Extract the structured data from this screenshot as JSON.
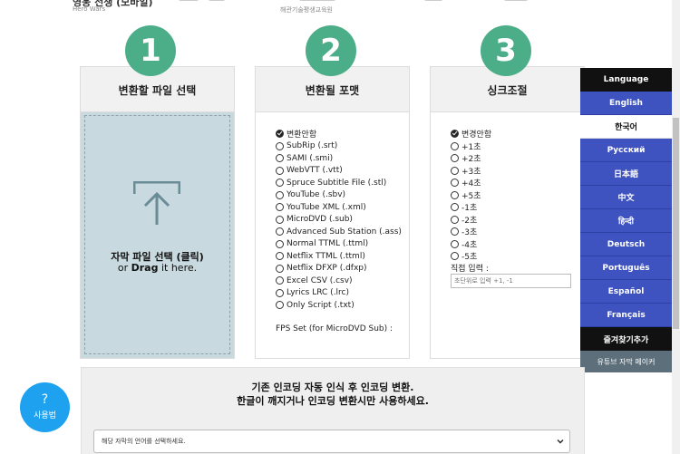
{
  "top_ad": {
    "title": "영웅 전쟁 (모바일)",
    "subtitle_left": "Hero Wars",
    "subtitle_center": "해관기술평생교육원"
  },
  "steps": [
    {
      "number": "1",
      "title": "변환할 파일 선택"
    },
    {
      "number": "2",
      "title": "변환될 포맷"
    },
    {
      "number": "3",
      "title": "싱크조절"
    }
  ],
  "drop_zone": {
    "line1": "자막 파일 선택 (클릭)",
    "line2_prefix": "or ",
    "line2_bold": "Drag",
    "line2_suffix": " it here."
  },
  "formats": [
    "변환안함",
    "SubRip (.srt)",
    "SAMI (.smi)",
    "WebVTT (.vtt)",
    "Spruce Subtitle File (.stl)",
    "YouTube (.sbv)",
    "YouTube XML (.xml)",
    "MicroDVD (.sub)",
    "Advanced Sub Station (.ass)",
    "Normal TTML (.ttml)",
    "Netflix TTML (.ttml)",
    "Netflix DFXP (.dfxp)",
    "Excel CSV (.csv)",
    "Lyrics LRC (.lrc)",
    "Only Script (.txt)"
  ],
  "fps_label": "FPS Set (for MicroDVD Sub) :",
  "sync_options": [
    "변경안함",
    "+1초",
    "+2초",
    "+3초",
    "+4초",
    "+5초",
    "-1초",
    "-2초",
    "-3초",
    "-4초",
    "-5초"
  ],
  "direct_input": {
    "label": "직접 입력 :",
    "placeholder": "초단위로 입력 +1, -1"
  },
  "language_panel": {
    "header": "Language",
    "languages": [
      "English",
      "한국어",
      "Русский",
      "日本語",
      "中文",
      "हिन्दी",
      "Deutsch",
      "Português",
      "Español",
      "Français"
    ],
    "active": "한국어",
    "bookmark": "즐겨찾기추가",
    "youtube_maker": "유튜브 자막 메이커"
  },
  "bottom": {
    "line1": "기존 인코딩 자동 인식 후 인코딩 변환.",
    "line2": "한글이 깨지거나 인코딩 변환시만 사용하세요.",
    "select_value": "해당 자막의 언어를 선택하세요."
  },
  "help_button": {
    "symbol": "?",
    "label": "사용법"
  },
  "colors": {
    "step_green": "#4cae88",
    "lang_blue": "#3e52c0",
    "help_blue": "#1ea2f0",
    "drop_bg": "#c8d9df"
  }
}
